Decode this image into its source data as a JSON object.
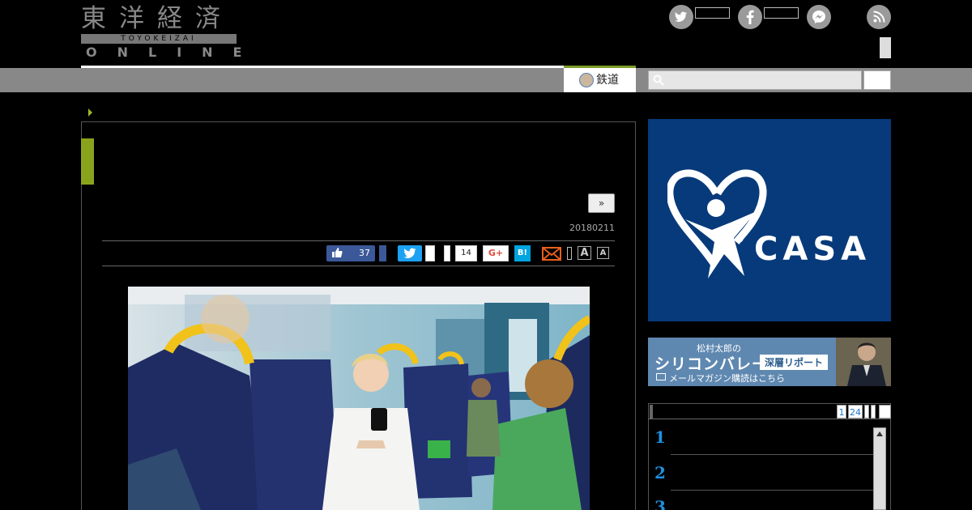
{
  "header": {
    "logo_jp": "東洋経済",
    "logo_en_small": "TOYOKEIZAI",
    "logo_en": "ONLINE"
  },
  "sns": {
    "twitter_icon": "twitter-icon",
    "facebook_icon": "facebook-icon",
    "messenger_icon": "messenger-icon",
    "rss_icon": "rss-icon"
  },
  "nav": {
    "active_tab": "鉄道"
  },
  "article": {
    "next_label": "»",
    "date": "20180211",
    "fb_like_count": "37",
    "pocket_count": "14",
    "gplus_label": "G+",
    "hatena_label": "B!",
    "font_large": "A",
    "font_small": "A"
  },
  "ads": {
    "casa_text": "CASA",
    "casa_registered": "®",
    "sv_top": "松村太郎の",
    "sv_main": "シリコンバレー",
    "sv_tag": "深層リポート",
    "sv_bottom": "メールマガジン購読はこちら"
  },
  "ranking": {
    "pages": [
      "1",
      "24"
    ],
    "numbers": [
      "1",
      "2",
      "3"
    ]
  },
  "colors": {
    "accent_green": "#8aa31c",
    "nav_gray": "#888888",
    "facebook_blue": "#3b5998",
    "twitter_blue": "#1da1f2",
    "hatena_blue": "#00a4de",
    "casa_blue": "#073a7a"
  }
}
